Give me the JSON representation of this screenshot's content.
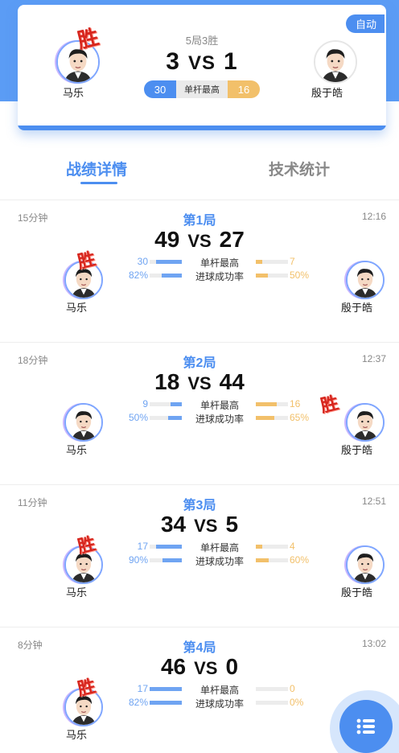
{
  "summary": {
    "mode_badge": "自动",
    "record": "5局3胜",
    "left_score": "3",
    "vs": "VS",
    "right_score": "1",
    "left_name": "马乐",
    "right_name": "殷于皓",
    "win_label": "胜",
    "compare": {
      "left_value": "30",
      "label": "单杆最高",
      "right_value": "16"
    }
  },
  "tabs": [
    {
      "label": "战绩详情",
      "active": true
    },
    {
      "label": "技术统计",
      "active": false
    }
  ],
  "rounds": [
    {
      "duration": "15分钟",
      "title": "第1局",
      "time": "12:16",
      "left_score": "49",
      "vs": "VS",
      "right_score": "27",
      "left_name": "马乐",
      "right_name": "殷于皓",
      "winner": "left",
      "win_label": "胜",
      "stats": [
        {
          "left": "30",
          "label": "单杆最高",
          "right": "7",
          "left_fraction": 0.81,
          "right_fraction": 0.19
        },
        {
          "left": "82%",
          "label": "进球成功率",
          "right": "50%",
          "left_fraction": 0.62,
          "right_fraction": 0.38
        }
      ]
    },
    {
      "duration": "18分钟",
      "title": "第2局",
      "time": "12:37",
      "left_score": "18",
      "vs": "VS",
      "right_score": "44",
      "left_name": "马乐",
      "right_name": "殷于皓",
      "winner": "right",
      "win_label": "胜",
      "stats": [
        {
          "left": "9",
          "label": "单杆最高",
          "right": "16",
          "left_fraction": 0.36,
          "right_fraction": 0.64
        },
        {
          "left": "50%",
          "label": "进球成功率",
          "right": "65%",
          "left_fraction": 0.43,
          "right_fraction": 0.57
        }
      ]
    },
    {
      "duration": "11分钟",
      "title": "第3局",
      "time": "12:51",
      "left_score": "34",
      "vs": "VS",
      "right_score": "5",
      "left_name": "马乐",
      "right_name": "殷于皓",
      "winner": "left",
      "win_label": "胜",
      "stats": [
        {
          "left": "17",
          "label": "单杆最高",
          "right": "4",
          "left_fraction": 0.81,
          "right_fraction": 0.19
        },
        {
          "left": "90%",
          "label": "进球成功率",
          "right": "60%",
          "left_fraction": 0.6,
          "right_fraction": 0.4
        }
      ]
    },
    {
      "duration": "8分钟",
      "title": "第4局",
      "time": "13:02",
      "left_score": "46",
      "vs": "VS",
      "right_score": "0",
      "left_name": "马乐",
      "right_name": "",
      "winner": "left",
      "win_label": "胜",
      "stats": [
        {
          "left": "17",
          "label": "单杆最高",
          "right": "0",
          "left_fraction": 1.0,
          "right_fraction": 0.0
        },
        {
          "left": "82%",
          "label": "进球成功率",
          "right": "0%",
          "left_fraction": 1.0,
          "right_fraction": 0.0
        }
      ]
    }
  ],
  "fab": {
    "icon": "list-menu-icon"
  },
  "colors": {
    "primary": "#4c8ef0",
    "secondary": "#f2c06a",
    "win": "#d6261e"
  }
}
